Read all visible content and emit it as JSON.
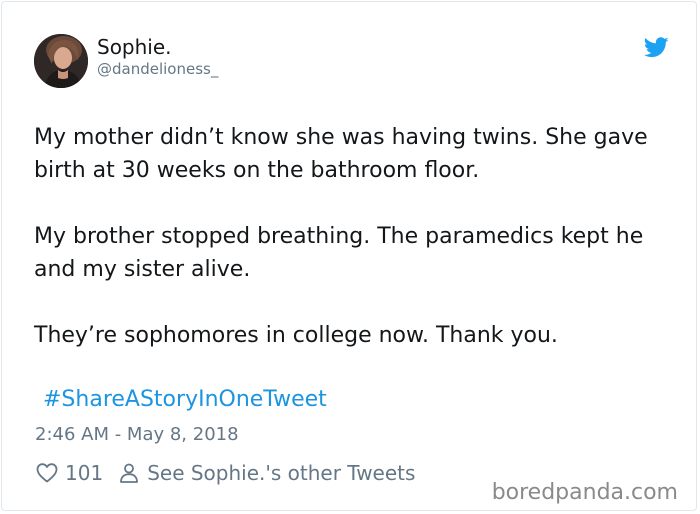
{
  "user": {
    "display_name": "Sophie.",
    "handle": "@dandelioness_"
  },
  "icons": {
    "brand": "twitter-bird-icon",
    "like": "heart-icon",
    "profile": "person-icon"
  },
  "tweet": {
    "paragraphs": [
      "My mother didn’t know she was having twins. She gave birth at 30 weeks on the bathroom floor.",
      "My brother stopped breathing. The paramedics kept he and my sister alive.",
      "They’re sophomores in college now. Thank you."
    ],
    "hashtag": "#ShareAStoryInOneTweet",
    "timestamp": "2:46 AM - May 8, 2018"
  },
  "actions": {
    "like_count": "101",
    "see_other_label": "See Sophie.'s other Tweets"
  },
  "watermark": "boredpanda.com",
  "colors": {
    "link": "#1b95e0",
    "secondary_text": "#657786",
    "twitter_blue": "#1da1f2"
  }
}
